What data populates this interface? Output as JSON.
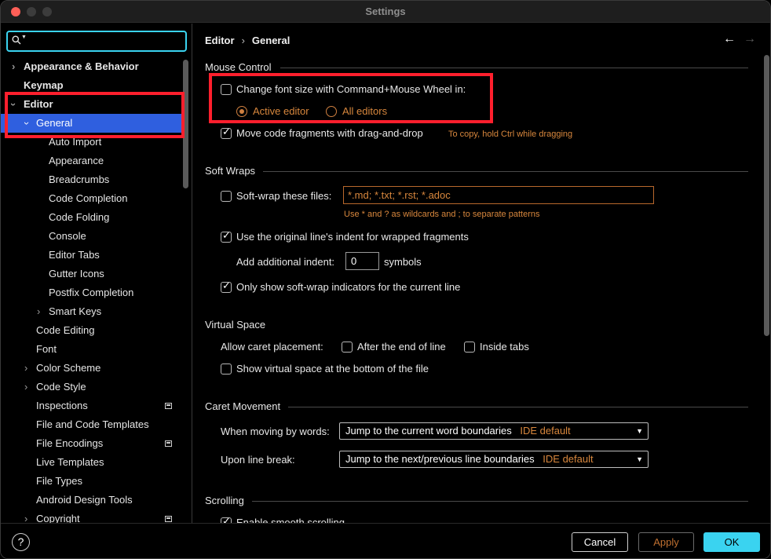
{
  "window": {
    "title": "Settings"
  },
  "search": {
    "value": "",
    "placeholder": ""
  },
  "sidebar": {
    "items": [
      {
        "label": "Appearance & Behavior",
        "arrow": "›"
      },
      {
        "label": "Keymap"
      },
      {
        "label": "Editor",
        "arrow": "›"
      },
      {
        "label": "General",
        "arrow": "›"
      },
      {
        "label": "Auto Import"
      },
      {
        "label": "Appearance"
      },
      {
        "label": "Breadcrumbs"
      },
      {
        "label": "Code Completion"
      },
      {
        "label": "Code Folding"
      },
      {
        "label": "Console"
      },
      {
        "label": "Editor Tabs"
      },
      {
        "label": "Gutter Icons"
      },
      {
        "label": "Postfix Completion"
      },
      {
        "label": "Smart Keys",
        "arrow": "›"
      },
      {
        "label": "Code Editing"
      },
      {
        "label": "Font"
      },
      {
        "label": "Color Scheme",
        "arrow": "›"
      },
      {
        "label": "Code Style",
        "arrow": "›"
      },
      {
        "label": "Inspections"
      },
      {
        "label": "File and Code Templates"
      },
      {
        "label": "File Encodings"
      },
      {
        "label": "Live Templates"
      },
      {
        "label": "File Types"
      },
      {
        "label": "Android Design Tools"
      },
      {
        "label": "Copyright",
        "arrow": "›"
      }
    ]
  },
  "breadcrumb": {
    "parent": "Editor",
    "separator": "›",
    "current": "General"
  },
  "nav": {
    "back": "←",
    "forward": "→"
  },
  "mouse_control": {
    "title": "Mouse Control",
    "font_size_wheel": {
      "label": "Change font size with Command+Mouse Wheel in:",
      "checked": false
    },
    "radio_active": {
      "label": "Active editor",
      "selected": true
    },
    "radio_all": {
      "label": "All editors",
      "selected": false
    },
    "drag_drop": {
      "label": "Move code fragments with drag-and-drop",
      "checked": true,
      "hint": "To copy, hold Ctrl while dragging"
    }
  },
  "soft_wraps": {
    "title": "Soft Wraps",
    "soft_wrap_files": {
      "label": "Soft-wrap these files:",
      "checked": false,
      "value": "*.md; *.txt; *.rst; *.adoc",
      "hint": "Use * and ? as wildcards and ; to separate patterns"
    },
    "original_indent": {
      "label": "Use the original line's indent for wrapped fragments",
      "checked": true
    },
    "additional_indent": {
      "label": "Add additional indent:",
      "value": "0",
      "unit": "symbols"
    },
    "only_current_line": {
      "label": "Only show soft-wrap indicators for the current line",
      "checked": true
    }
  },
  "virtual_space": {
    "title": "Virtual Space",
    "allow_caret_label": "Allow caret placement:",
    "after_end": {
      "label": "After the end of line",
      "checked": false
    },
    "inside_tabs": {
      "label": "Inside tabs",
      "checked": false
    },
    "show_virtual": {
      "label": "Show virtual space at the bottom of the file",
      "checked": false
    }
  },
  "caret_movement": {
    "title": "Caret Movement",
    "by_words": {
      "label": "When moving by words:",
      "value": "Jump to the current word boundaries",
      "tag": "IDE default"
    },
    "line_break": {
      "label": "Upon line break:",
      "value": "Jump to the next/previous line boundaries",
      "tag": "IDE default"
    }
  },
  "scrolling": {
    "title": "Scrolling",
    "smooth": {
      "label": "Enable smooth scrolling",
      "checked": true
    }
  },
  "footer": {
    "help": "?",
    "cancel": "Cancel",
    "apply": "Apply",
    "ok": "OK"
  },
  "colors": {
    "accent": "#3ad3f0",
    "selection": "#2f5fdf",
    "hint": "#d8873d",
    "highlight_box": "#ff1f2d"
  }
}
